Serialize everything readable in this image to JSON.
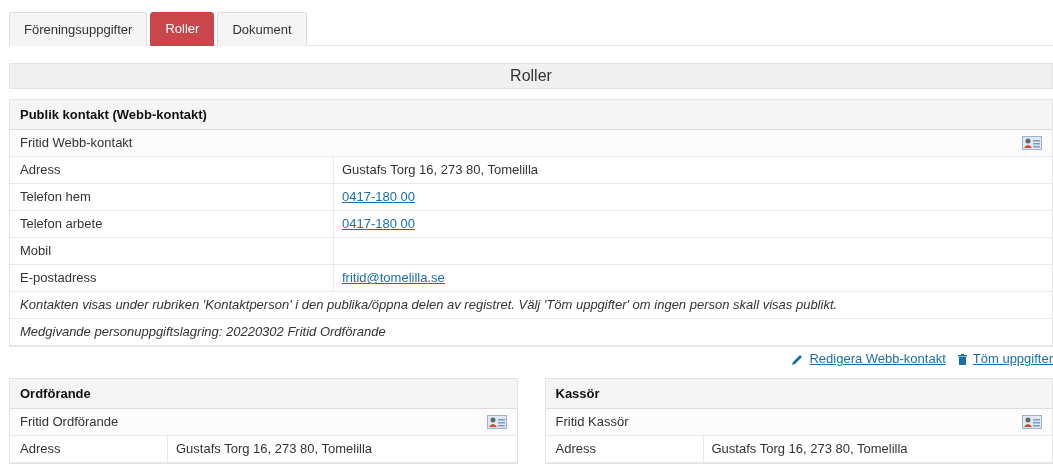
{
  "tabs": [
    {
      "label": "Föreningsuppgifter",
      "selected": false
    },
    {
      "label": "Roller",
      "selected": true
    },
    {
      "label": "Dokument",
      "selected": false
    }
  ],
  "section_title": "Roller",
  "public_contact": {
    "title": "Publik kontakt (Webb-kontakt)",
    "name": "Fritid Webb-kontakt",
    "rows": [
      {
        "label": "Adress",
        "value": "Gustafs Torg 16, 273 80, Tomelilla"
      },
      {
        "label": "Telefon hem",
        "value": "0417-180 00",
        "kind": "link"
      },
      {
        "label": "Telefon arbete",
        "value": "0417-180 00",
        "kind": "link"
      },
      {
        "label": "Mobil"
      },
      {
        "label": "E-postadress",
        "value": "fritid@tomelilla.se",
        "kind": "link"
      }
    ],
    "notes": [
      "Kontakten visas under rubriken 'Kontaktperson' i den publika/öppna delen av registret. Välj 'Töm uppgifter' om ingen person skall visas publikt.",
      "Medgivande personuppgiftslagring: 20220302 Fritid Ordförande"
    ],
    "actions": [
      {
        "label": "Redigera Webb-kontakt",
        "kind": "edit"
      },
      {
        "label": "Töm uppgifter",
        "kind": "clear"
      }
    ]
  },
  "role_panels": [
    {
      "title": "Ordförande",
      "name": "Fritid Ordförande",
      "rows": [
        {
          "label": "Adress",
          "value": "Gustafs Torg 16, 273 80, Tomelilla"
        }
      ]
    },
    {
      "title": "Kassör",
      "name": "Fritid Kassör",
      "rows": [
        {
          "label": "Adress",
          "value": "Gustafs Torg 16, 273 80, Tomelilla"
        }
      ]
    }
  ]
}
